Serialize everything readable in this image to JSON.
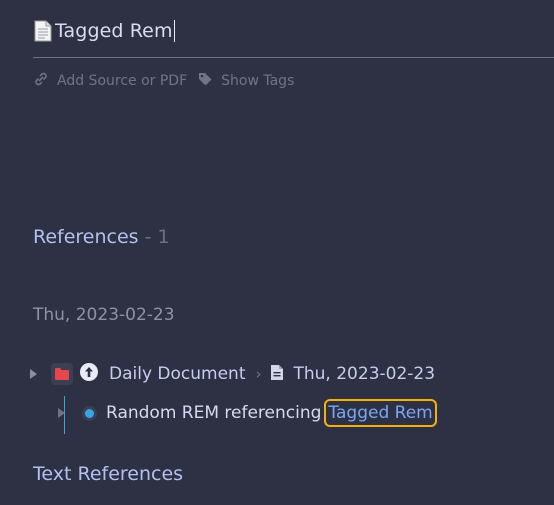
{
  "document": {
    "title": "Tagged Rem",
    "icon": "page-icon"
  },
  "meta": {
    "add_source_label": "Add Source or PDF",
    "show_tags_label": "Show Tags"
  },
  "references": {
    "heading": "References",
    "count_text": " - 1",
    "groups": [
      {
        "date": "Thu, 2023-02-23",
        "breadcrumb": [
          "Daily Document",
          "Thu, 2023-02-23"
        ],
        "rem_text": "Random REM referencing ",
        "link_text": "Tagged Rem"
      }
    ]
  },
  "text_references": {
    "heading": "Text References"
  },
  "colors": {
    "background": "#2e3143",
    "accent_link": "#79a7f5",
    "highlight_border": "#f3b10f",
    "folder_red": "#e8464b",
    "bullet_blue": "#36a6e4"
  }
}
